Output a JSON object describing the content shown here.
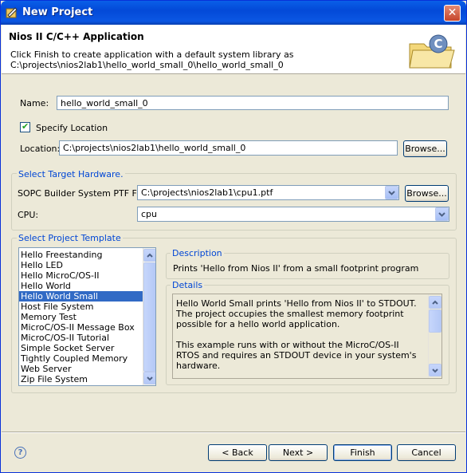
{
  "window": {
    "title": "New Project",
    "close_glyph": "✕"
  },
  "banner": {
    "title": "Nios II C/C++ Application",
    "description_line1": "Click Finish to create application with a default system library as",
    "description_line2": "C:\\projects\\nios2lab1\\hello_world_small_0\\hello_world_small_0",
    "icon": "project-folder-icon"
  },
  "name_field": {
    "label": "Name:",
    "value": "hello_world_small_0"
  },
  "specify_location": {
    "label": "Specify Location",
    "checked": true,
    "check_glyph": "✔"
  },
  "location_field": {
    "label": "Location:",
    "value": "C:\\projects\\nios2lab1\\hello_world_small_0",
    "browse_label": "Browse..."
  },
  "target_hardware": {
    "group_title": "Select Target Hardware.",
    "ptf_label": "SOPC Builder System PTF File:",
    "ptf_value": "C:\\projects\\nios2lab1\\cpu1.ptf",
    "browse_label": "Browse...",
    "cpu_label": "CPU:",
    "cpu_value": "cpu"
  },
  "project_template": {
    "group_title": "Select Project Template",
    "items": [
      "Hello Freestanding",
      "Hello LED",
      "Hello MicroC/OS-II",
      "Hello World",
      "Hello World Small",
      "Host File System",
      "Memory Test",
      "MicroC/OS-II Message Box",
      "MicroC/OS-II Tutorial",
      "Simple Socket Server",
      "Tightly Coupled Memory",
      "Web Server",
      "Zip File System"
    ],
    "selected_index": 4,
    "description_title": "Description",
    "description_text": "Prints 'Hello from Nios II' from a small footprint program",
    "details_title": "Details",
    "details_para1": "Hello World Small prints 'Hello from Nios II' to STDOUT.  The project occupies the smallest memory footprint possible for a hello world application.",
    "details_para2": "This example runs with or without the MicroC/OS-II RTOS and requires an STDOUT device in your system's hardware."
  },
  "footer": {
    "help_glyph": "?",
    "back_label": "< Back",
    "next_label": "Next >",
    "finish_label": "Finish",
    "cancel_label": "Cancel"
  },
  "colors": {
    "titlebar": "#0a5fe8",
    "group_title": "#0046d5",
    "selection": "#316ac5"
  }
}
